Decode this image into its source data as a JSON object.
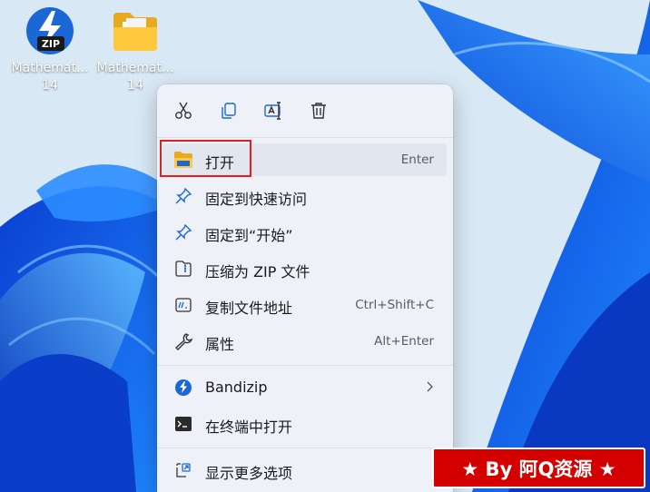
{
  "desktop": {
    "icons": [
      {
        "label_line1": "Mathemat...",
        "label_line2": "14",
        "icon": "zip-archive-icon"
      },
      {
        "label_line1": "Mathemat...",
        "label_line2": "14",
        "icon": "folder-icon"
      }
    ]
  },
  "toolbar": {
    "buttons": [
      {
        "icon": "cut-icon"
      },
      {
        "icon": "copy-icon"
      },
      {
        "icon": "rename-icon"
      },
      {
        "icon": "delete-icon"
      }
    ]
  },
  "menu": {
    "items": [
      {
        "label": "打开",
        "shortcut": "Enter",
        "icon": "folder-open-icon"
      },
      {
        "label": "固定到快速访问",
        "shortcut": "",
        "icon": "pin-icon"
      },
      {
        "label": "固定到“开始”",
        "shortcut": "",
        "icon": "pin-icon"
      },
      {
        "label": "压缩为 ZIP 文件",
        "shortcut": "",
        "icon": "zip-compress-icon"
      },
      {
        "label": "复制文件地址",
        "shortcut": "Ctrl+Shift+C",
        "icon": "copy-path-icon"
      },
      {
        "label": "属性",
        "shortcut": "Alt+Enter",
        "icon": "wrench-icon"
      },
      {
        "label": "Bandizip",
        "shortcut": "",
        "icon": "bandizip-icon"
      },
      {
        "label": "在终端中打开",
        "shortcut": "",
        "icon": "terminal-icon"
      },
      {
        "label": "显示更多选项",
        "shortcut": "",
        "icon": "more-options-icon"
      }
    ]
  },
  "watermark": {
    "text": "★ By 阿Q资源 ★"
  },
  "colors": {
    "accent": "#1b67d6",
    "highlight_border": "#e02020",
    "watermark_bg": "#d40000"
  }
}
